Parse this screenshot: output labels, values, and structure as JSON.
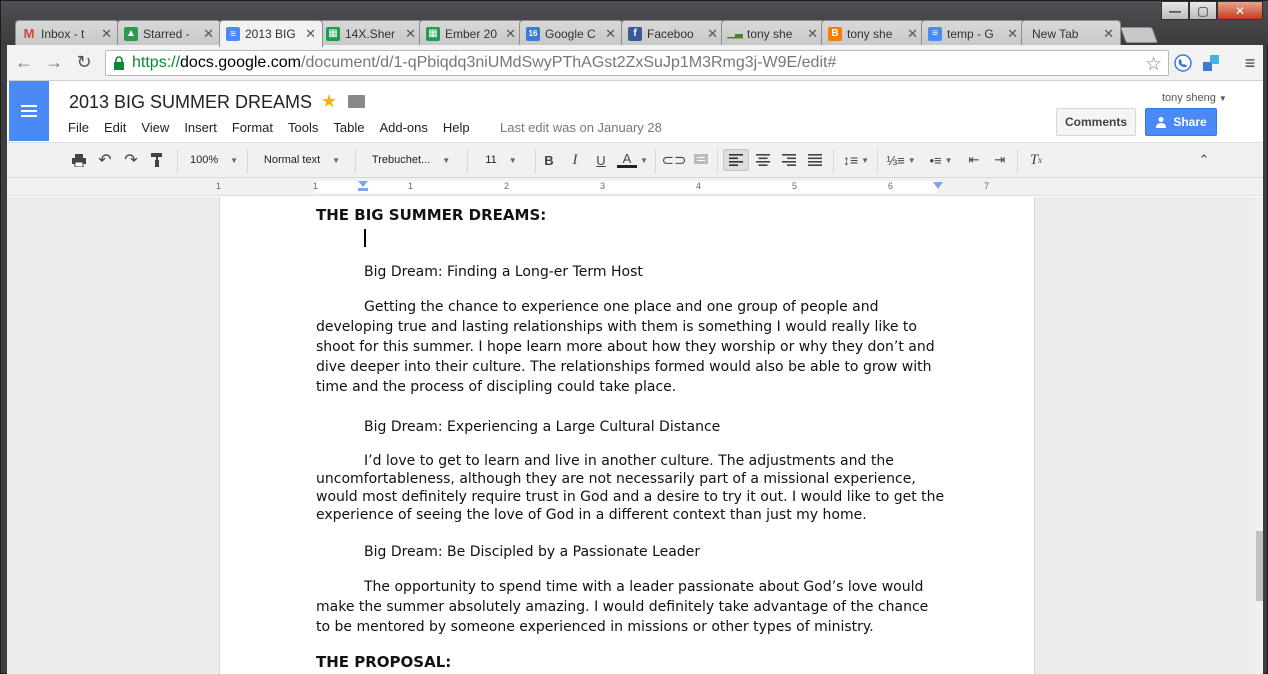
{
  "tabs": [
    {
      "label": "Inbox - t",
      "icon": "gmail-icon",
      "color": "#d44638",
      "glyph": "M"
    },
    {
      "label": "Starred -",
      "icon": "drive-icon",
      "color": "#2b9b50",
      "glyph": "▲"
    },
    {
      "label": "2013 BIG",
      "icon": "docs-icon",
      "color": "#4a8af4",
      "glyph": "≡"
    },
    {
      "label": "14X.Sher",
      "icon": "sheets-icon",
      "color": "#1e9c4f",
      "glyph": "▦"
    },
    {
      "label": "Ember 20",
      "icon": "sheets-icon",
      "color": "#1e9c4f",
      "glyph": "▦"
    },
    {
      "label": "Google C",
      "icon": "calendar-icon",
      "color": "#3a7bd5",
      "glyph": "16"
    },
    {
      "label": "Faceboo",
      "icon": "facebook-icon",
      "color": "#3b5998",
      "glyph": "f"
    },
    {
      "label": "tony she",
      "icon": "chart-icon",
      "color": "#4f7f2f",
      "glyph": "▁"
    },
    {
      "label": "tony she",
      "icon": "blogger-icon",
      "color": "#f57d00",
      "glyph": "B"
    },
    {
      "label": "temp - G",
      "icon": "docs-icon",
      "color": "#4a8af4",
      "glyph": "≡"
    },
    {
      "label": "New Tab",
      "icon": "",
      "color": "",
      "glyph": ""
    }
  ],
  "url": {
    "scheme": "https://",
    "host": "docs.google.com",
    "path": "/document/d/1-qPbiqdq3niUMdSwyPThAGst2ZxSuJp1M3Rmg3j-W9E/edit#"
  },
  "doc": {
    "title": "2013 BIG SUMMER DREAMS",
    "menu": [
      "File",
      "Edit",
      "View",
      "Insert",
      "Format",
      "Tools",
      "Table",
      "Add-ons",
      "Help"
    ],
    "last_edit": "Last edit was on January 28",
    "user": "tony sheng",
    "comments_label": "Comments",
    "share_label": "Share"
  },
  "toolbar": {
    "zoom": "100%",
    "style": "Normal text",
    "font": "Trebuchet...",
    "size": "11"
  },
  "ruler_numbers": [
    "1",
    "1",
    "1",
    "2",
    "3",
    "4",
    "5",
    "6",
    "7"
  ],
  "content": {
    "heading": "THE BIG SUMMER DREAMS:",
    "dream1_title": "Big Dream: Finding a Long-er Term Host",
    "dream1_body": "Getting the chance to experience one place and one group of people and developing true and lasting relationships with them is something I would really like to shoot for this summer. I hope learn more about how they worship or why they don’t and dive deeper into their culture. The relationships formed would also be able to grow with time and the process of discipling could take place.",
    "dream2_title": "Big Dream: Experiencing a Large Cultural Distance",
    "dream2_body": "I’d love to get to learn and live in another culture. The adjustments and the uncomfortableness, although they are not necessarily part of a missional experience, would most definitely require trust in God and a desire to try it out. I would like to get the experience of seeing the love of God in a different context than just my home.",
    "dream3_title": "Big Dream: Be Discipled by a Passionate Leader",
    "dream3_body": "The opportunity to spend time with a leader passionate about God’s love would make the summer absolutely amazing. I would definitely take advantage of the chance to be mentored by someone experienced in missions or other types of ministry.",
    "heading2": "THE PROPOSAL:"
  },
  "colors": {
    "docs_blue": "#4a8af4",
    "text_color_bar": "#222222"
  }
}
